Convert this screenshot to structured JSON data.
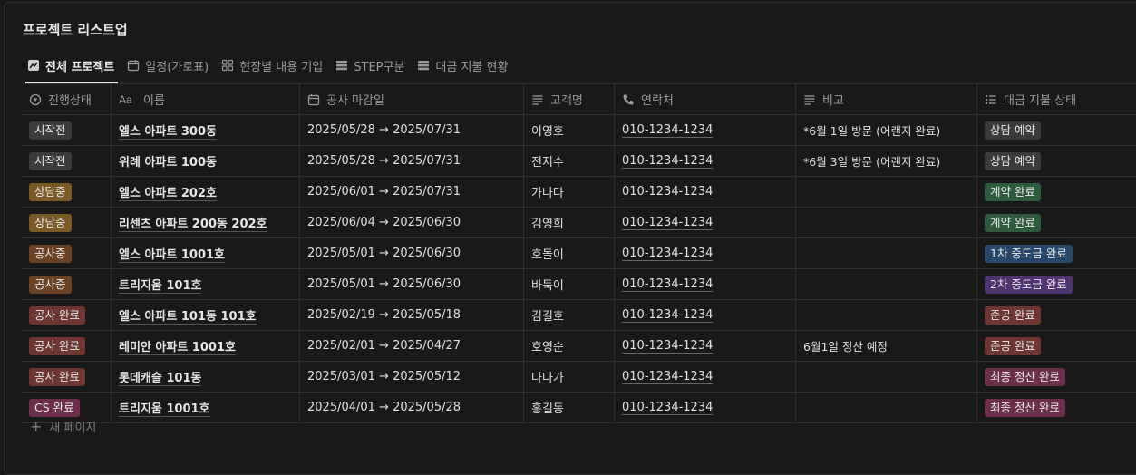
{
  "title": "프로젝트 리스트업",
  "views": [
    {
      "label": "전체 프로젝트",
      "icon": "chart-icon",
      "active": true
    },
    {
      "label": "일정(가로표)",
      "icon": "calendar-icon",
      "active": false
    },
    {
      "label": "현장별 내용 기입",
      "icon": "gallery-icon",
      "active": false
    },
    {
      "label": "STEP구분",
      "icon": "table-icon",
      "active": false
    },
    {
      "label": "대금 지불 현황",
      "icon": "table-icon",
      "active": false
    }
  ],
  "columns": [
    {
      "label": "진행상태",
      "icon": "status-icon"
    },
    {
      "label": "이름",
      "icon": "title-icon"
    },
    {
      "label": "공사 마감일",
      "icon": "calendar-icon"
    },
    {
      "label": "고객명",
      "icon": "text-icon"
    },
    {
      "label": "연락처",
      "icon": "phone-icon"
    },
    {
      "label": "비고",
      "icon": "text-icon"
    },
    {
      "label": "대금 지불 상태",
      "icon": "list-icon"
    }
  ],
  "colors": {
    "시작전": "#3b3b3b",
    "상담중": "#7a5a25",
    "공사중": "#6b4224",
    "공사 완료": "#6e3630",
    "CS 완료": "#6b2f4b",
    "상담 예약": "#3b3b3b",
    "계약 완료": "#2f5a3d",
    "1차 중도금 완료": "#29476b",
    "2차 중도금 완료": "#4e3471",
    "준공 완료": "#6e3630",
    "최종 정산 완료": "#6b2f4b"
  },
  "rows": [
    {
      "status": "시작전",
      "name": "엘스 아파트 300동",
      "date": "2025/05/28 → 2025/07/31",
      "customer": "이영호",
      "phone": "010-1234-1234",
      "note": "*6월 1일 방문 (어랜지 완료)",
      "payment": "상담 예약"
    },
    {
      "status": "시작전",
      "name": "위례 아파트 100동",
      "date": "2025/05/28 → 2025/07/31",
      "customer": "전지수",
      "phone": "010-1234-1234",
      "note": "*6월 3일 방문 (어랜지 완료)",
      "payment": "상담 예약"
    },
    {
      "status": "상담중",
      "name": "엘스 아파트 202호",
      "date": "2025/06/01 → 2025/07/31",
      "customer": "가나다",
      "phone": "010-1234-1234",
      "note": "",
      "payment": "계약 완료"
    },
    {
      "status": "상담중",
      "name": "리센츠 아파트 200동 202호",
      "date": "2025/06/04 → 2025/06/30",
      "customer": "김영희",
      "phone": "010-1234-1234",
      "note": "",
      "payment": "계약 완료"
    },
    {
      "status": "공사중",
      "name": "엘스 아파트 1001호",
      "date": "2025/05/01 → 2025/06/30",
      "customer": "호돌이",
      "phone": "010-1234-1234",
      "note": "",
      "payment": "1차 중도금 완료"
    },
    {
      "status": "공사중",
      "name": "트리지움 101호",
      "date": "2025/05/01 → 2025/06/30",
      "customer": "바둑이",
      "phone": "010-1234-1234",
      "note": "",
      "payment": "2차 중도금 완료"
    },
    {
      "status": "공사 완료",
      "name": "엘스 아파트 101동 101호",
      "date": "2025/02/19 → 2025/05/18",
      "customer": "김길호",
      "phone": "010-1234-1234",
      "note": "",
      "payment": "준공 완료"
    },
    {
      "status": "공사 완료",
      "name": "레미안 아파트 1001호",
      "date": "2025/02/01 → 2025/04/27",
      "customer": "호영순",
      "phone": "010-1234-1234",
      "note": "6월1일 정산 예정",
      "payment": "준공 완료"
    },
    {
      "status": "공사 완료",
      "name": "롯데캐슬 101동",
      "date": "2025/03/01 → 2025/05/12",
      "customer": "나다가",
      "phone": "010-1234-1234",
      "note": "",
      "payment": "최종 정산 완료"
    },
    {
      "status": "CS 완료",
      "name": "트리지움 1001호",
      "date": "2025/04/01 → 2025/05/28",
      "customer": "홍길동",
      "phone": "010-1234-1234",
      "note": "",
      "payment": "최종 정산 완료"
    }
  ],
  "new_page_label": "새 페이지"
}
